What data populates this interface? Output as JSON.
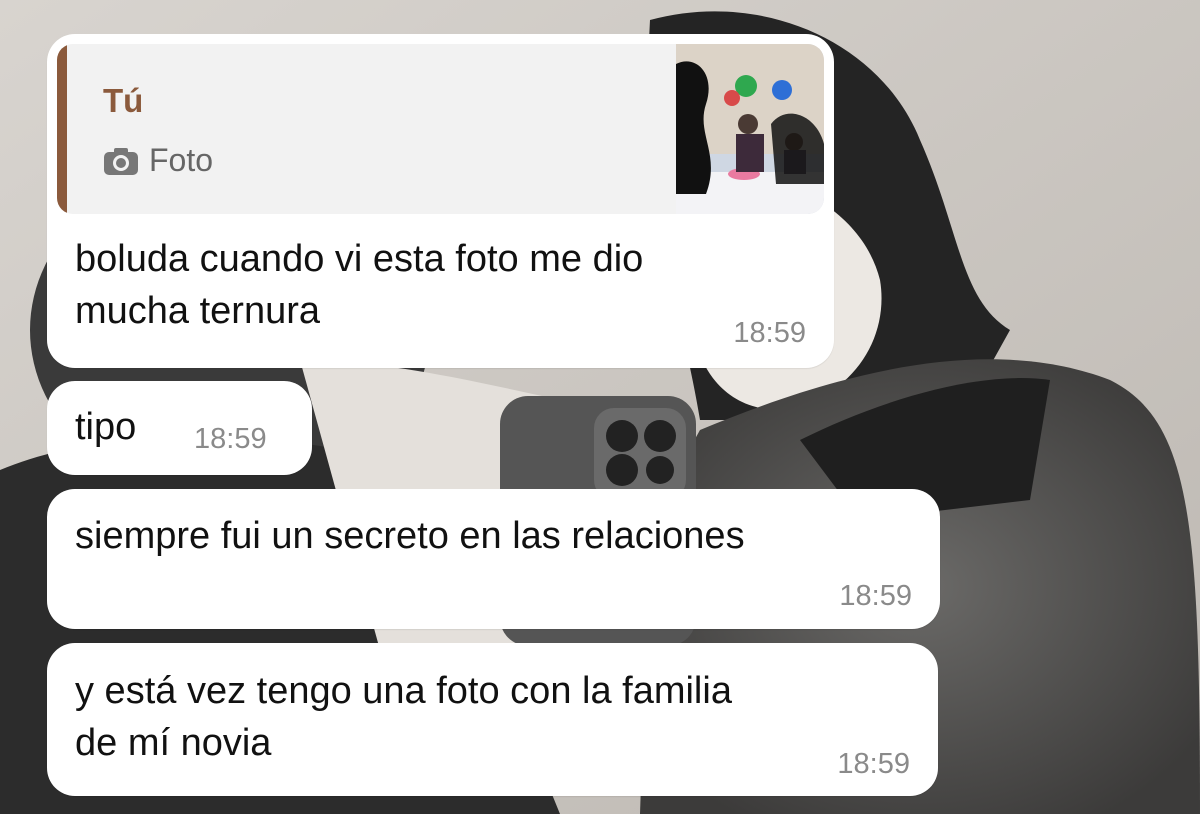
{
  "messages": [
    {
      "reply": {
        "author": "Tú",
        "media_label": "Foto",
        "media_icon": "camera-icon"
      },
      "text": "boluda cuando vi esta foto me dio\nmucha ternura",
      "time": "18:59"
    },
    {
      "text": "tipo",
      "time": "18:59"
    },
    {
      "text": "siempre fui un secreto en las relaciones",
      "time": "18:59"
    },
    {
      "text": "y está vez tengo una foto con la familia\nde mí novia",
      "time": "18:59"
    }
  ],
  "colors": {
    "bubble": "#ffffff",
    "reply_accent": "#8b5a3c",
    "timestamp": "#8a8a8a"
  }
}
